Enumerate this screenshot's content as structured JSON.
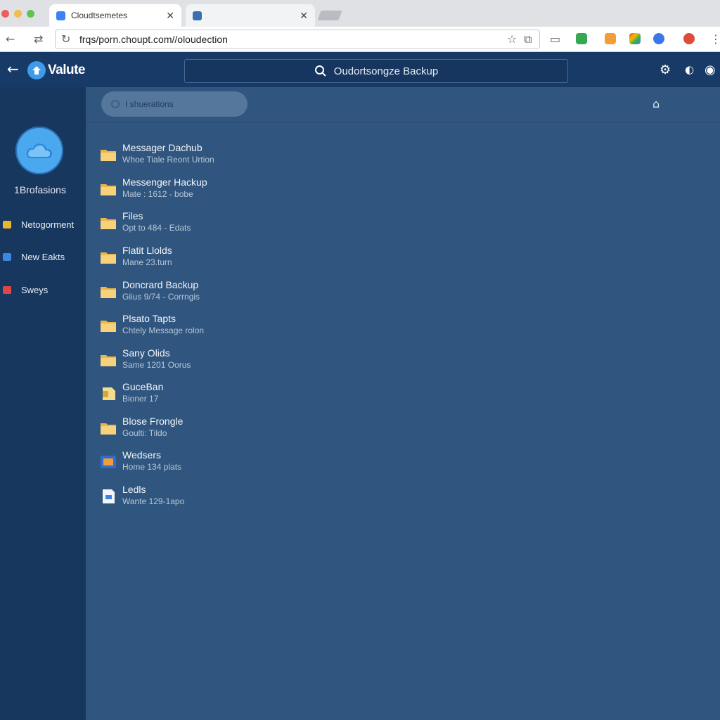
{
  "browser": {
    "tabs": [
      {
        "title": "Cloudtsemetes"
      },
      {
        "title": ""
      }
    ],
    "url": "frqs/porn.choupt.com//oloudection"
  },
  "app": {
    "brand": "Valute",
    "search_text": "Oudortsongze Backup"
  },
  "sidebar": {
    "title": "1Brofasions",
    "items": [
      {
        "label": "Netogorment",
        "color": "#e7b829"
      },
      {
        "label": "New Eakts",
        "color": "#3d86e0"
      },
      {
        "label": "Sweys",
        "color": "#e04646"
      }
    ]
  },
  "main": {
    "filter_text": "I shuerations",
    "files": [
      {
        "name": "Messager Dachub",
        "sub": "Whoe Tiale Reont Urtion",
        "icon": "folder-icon"
      },
      {
        "name": "Messenger Hackup",
        "sub": "Mate : 1612 - bobe",
        "icon": "folder-icon"
      },
      {
        "name": "Files",
        "sub": "Opt to 484 - Edats",
        "icon": "folder-icon"
      },
      {
        "name": "Flatit Llolds",
        "sub": "Mane 23.turn",
        "icon": "folder-icon"
      },
      {
        "name": "Doncrard Backup",
        "sub": "Glius 9/74 - Corrngis",
        "icon": "folder-icon"
      },
      {
        "name": "Plsato Tapts",
        "sub": "Chtely Message rolon",
        "icon": "folder-icon"
      },
      {
        "name": "Sany Olids",
        "sub": "Same 1201 Oorus",
        "icon": "folder-icon"
      },
      {
        "name": "GuceBan",
        "sub": "Bioner 17",
        "icon": "document-icon"
      },
      {
        "name": "Blose Frongle",
        "sub": "Goulti: Tildo",
        "icon": "folder-icon"
      },
      {
        "name": "Wedsers",
        "sub": "Home 134 plats",
        "icon": "app-icon"
      },
      {
        "name": "Ledls",
        "sub": "Wante 129-1apo",
        "icon": "file-icon"
      }
    ]
  }
}
